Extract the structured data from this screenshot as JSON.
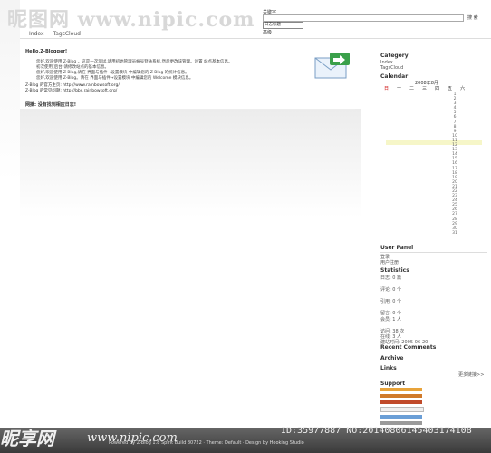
{
  "watermark_top": "昵图网 www.nipic.com",
  "watermark_bottom_brand": "昵享网",
  "watermark_bottom_url": "www.nipic.com",
  "watermark_bottom_id": "ID:35977887 NO:20140806145403174108",
  "nav": {
    "index": "Index",
    "tagscloud": "TagsCloud"
  },
  "search": {
    "label": "关键字",
    "button": "搜 索",
    "scope": "日志标题",
    "advanced": "高级"
  },
  "main": {
    "greeting": "Hello,Z-Blogger!",
    "para1": "您好,欢迎使用 Z-Blog 。这是一次测试,请用初始管理员帐号登陆系统,然后更改该管理。设置 站点基本信息。",
    "para2": "初次使用(后台)请修改站点的基本信息。",
    "para3": "您好,欢迎使用 Z-Blog,请在 界面与插件→设置模块 中编辑您的 Z-Blog 的统计信息。",
    "para4": "您好,欢迎使用 Z-Blog。请在 界面与插件→设置模块 中编辑您的 Welcome 模块信息。",
    "link1": "Z-Blog 的官方主页: http://www.rainbowsoft.org/",
    "link2": "Z-Blog 的常见问题: http://bbs.rainbowsoft.org/",
    "notice": "网摘: 没有找到相应日志!"
  },
  "sidebar": {
    "category_title": "Category",
    "category_items": [
      "Index",
      "TagsCloud"
    ],
    "calendar_title": "Calendar",
    "calendar_month": "2008年8月",
    "weekdays": [
      "日",
      "一",
      "二",
      "三",
      "四",
      "五",
      "六"
    ],
    "calendar_days": [
      "1",
      "2",
      "3",
      "4",
      "5",
      "6",
      "7",
      "8",
      "9",
      "10",
      "11",
      "12",
      "13",
      "14",
      "15",
      "16",
      "17",
      "18",
      "19",
      "20",
      "21",
      "22",
      "23",
      "24",
      "25",
      "26",
      "27",
      "28",
      "29",
      "30",
      "31"
    ],
    "user_panel_title": "User Panel",
    "user_panel_items": [
      "登录",
      "用户注册"
    ],
    "statistics_title": "Statistics",
    "stats": [
      "日志: 0 篇",
      "评论: 0 个",
      "引用: 0 个",
      "留言: 0 个",
      "会员: 1 人",
      "访问: 38 次",
      "在线: 3 人",
      "建站时间: 2005-06-20"
    ],
    "recent_title": "Recent Comments",
    "archive_title": "Archive",
    "links_title": "Links",
    "links_more": "更多链接>>",
    "support_title": "Support"
  },
  "footer": {
    "text": "Powered By Z-Blog 1.8 Spirit Build 80722 · Theme: Default · Design by Hooking Studio"
  },
  "colors": {
    "accent_link": "#1b3fa8",
    "footer_bg": "#3a3a3a"
  }
}
